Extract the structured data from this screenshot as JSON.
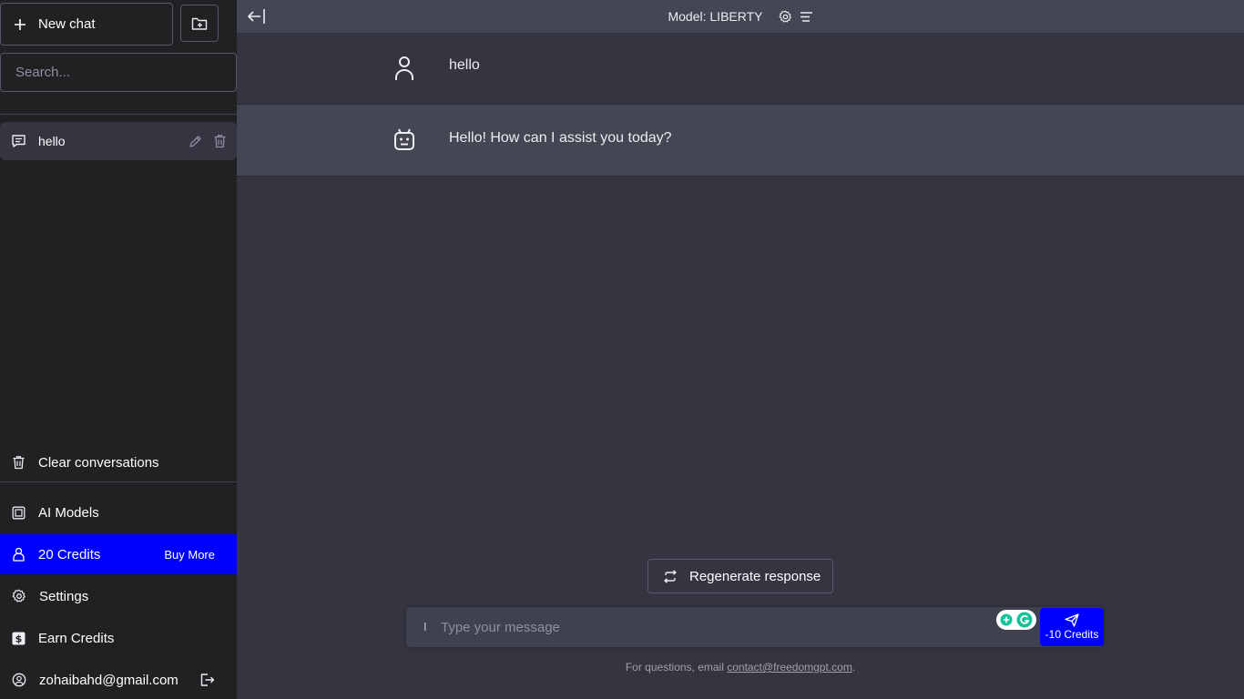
{
  "sidebar": {
    "new_chat_label": "New chat",
    "search_placeholder": "Search...",
    "conversations": [
      {
        "title": "hello"
      }
    ],
    "clear_label": "Clear conversations",
    "ai_models_label": "AI Models",
    "credits_label": "20 Credits",
    "buy_more_label": "Buy More",
    "settings_label": "Settings",
    "earn_credits_label": "Earn Credits",
    "account_email": "zohaibahd@gmail.com"
  },
  "header": {
    "model_label": "Model: LIBERTY"
  },
  "messages": [
    {
      "role": "user",
      "text": "hello"
    },
    {
      "role": "assistant",
      "text": "Hello! How can I assist you today?"
    }
  ],
  "regenerate_label": "Regenerate response",
  "composer": {
    "placeholder": "Type your message",
    "cursor_mark": "I",
    "send_cost_label": "-10 Credits"
  },
  "footer": {
    "prefix": "For questions, email ",
    "email": "contact@freedomgpt.com",
    "suffix": "."
  },
  "colors": {
    "sidebar_bg": "#202123",
    "main_bg": "#343541",
    "assistant_bg": "#444654",
    "accent_blue": "#0000ff"
  },
  "icons": [
    "plus-icon",
    "folder-plus-icon",
    "message-icon",
    "pencil-icon",
    "trash-icon",
    "box-icon",
    "user-icon",
    "gear-icon",
    "dollar-icon",
    "account-icon",
    "logout-icon",
    "arrow-left-icon",
    "lines-icon",
    "robot-icon",
    "refresh-icon",
    "send-icon"
  ]
}
